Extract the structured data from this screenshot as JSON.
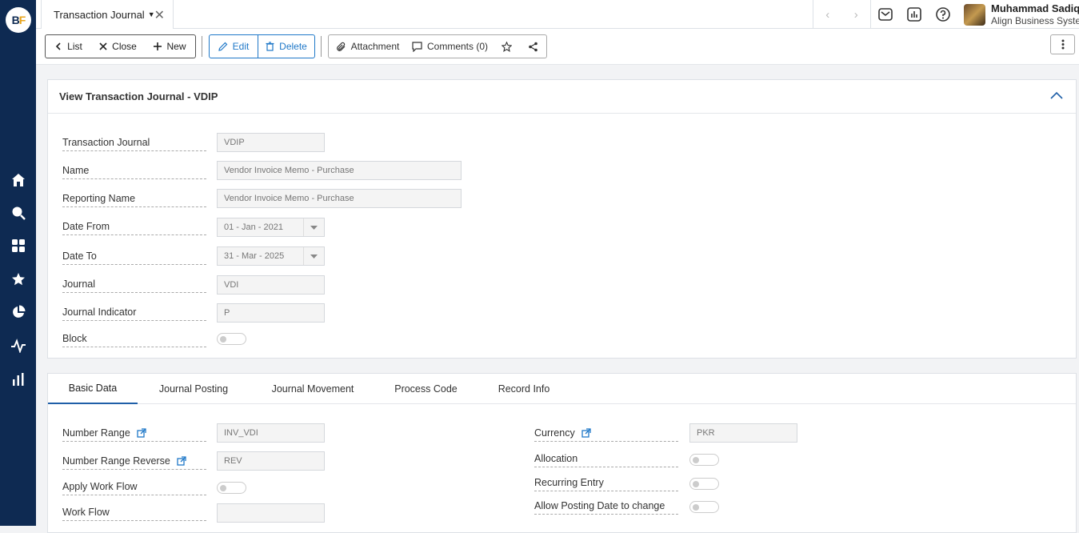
{
  "app": {
    "logo": "BF"
  },
  "topbar": {
    "tab_title": "Transaction Journal",
    "user_name": "Muhammad Sadiq",
    "user_org": "Align Business Systems"
  },
  "toolbar": {
    "list": "List",
    "close": "Close",
    "new": "New",
    "edit": "Edit",
    "delete": "Delete",
    "attachment": "Attachment",
    "comments": "Comments (0)"
  },
  "header_panel": {
    "title": "View Transaction Journal - VDIP",
    "fields": {
      "transaction_journal": {
        "label": "Transaction Journal",
        "value": "VDIP"
      },
      "name": {
        "label": "Name",
        "value": "Vendor Invoice Memo - Purchase"
      },
      "reporting_name": {
        "label": "Reporting Name",
        "value": "Vendor Invoice Memo - Purchase"
      },
      "date_from": {
        "label": "Date From",
        "value": "01 - Jan - 2021"
      },
      "date_to": {
        "label": "Date To",
        "value": "31 - Mar - 2025"
      },
      "journal": {
        "label": "Journal",
        "value": "VDI"
      },
      "journal_indicator": {
        "label": "Journal Indicator",
        "value": "P"
      },
      "block": {
        "label": "Block",
        "value": "off"
      }
    }
  },
  "detail_tabs": [
    "Basic Data",
    "Journal Posting",
    "Journal Movement",
    "Process Code",
    "Record Info"
  ],
  "basic_data": {
    "number_range": {
      "label": "Number Range",
      "value": "INV_VDI"
    },
    "number_range_reverse": {
      "label": "Number Range Reverse",
      "value": "REV"
    },
    "apply_work_flow": {
      "label": "Apply Work Flow",
      "value": "off"
    },
    "work_flow": {
      "label": "Work Flow",
      "value": ""
    },
    "currency": {
      "label": "Currency",
      "value": "PKR"
    },
    "allocation": {
      "label": "Allocation",
      "value": "off"
    },
    "recurring_entry": {
      "label": "Recurring Entry",
      "value": "off"
    },
    "allow_posting_date": {
      "label": "Allow Posting Date to change",
      "value": "off"
    }
  },
  "colors": {
    "sidebar": "#0e2a52",
    "accent": "#1f78c8"
  }
}
